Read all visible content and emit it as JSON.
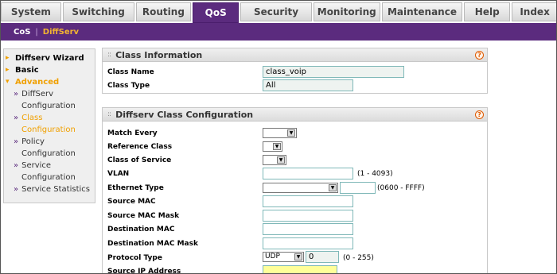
{
  "tabs": [
    "System",
    "Switching",
    "Routing",
    "QoS",
    "Security",
    "Monitoring",
    "Maintenance",
    "Help",
    "Index"
  ],
  "subnav": {
    "cos": "CoS",
    "sep": "|",
    "diffserv": "DiffServ"
  },
  "sidebar": {
    "wizard": "Diffserv Wizard",
    "basic": "Basic",
    "advanced": "Advanced",
    "items": [
      {
        "l1": "DiffServ",
        "l2": "Configuration"
      },
      {
        "l1": "Class",
        "l2": "Configuration"
      },
      {
        "l1": "Policy",
        "l2": "Configuration"
      },
      {
        "l1": "Service",
        "l2": "Configuration"
      },
      {
        "l1": "Service Statistics",
        "l2": ""
      }
    ]
  },
  "class_info": {
    "title": "Class Information",
    "name_label": "Class Name",
    "name_value": "class_voip",
    "type_label": "Class Type",
    "type_value": "All"
  },
  "config": {
    "title": "Diffserv Class Configuration",
    "match_every": "Match Every",
    "reference_class": "Reference Class",
    "class_of_service": "Class of Service",
    "vlan": "VLAN",
    "vlan_hint": "(1 - 4093)",
    "ethernet_type": "Ethernet Type",
    "ethernet_hint": "(0600 - FFFF)",
    "source_mac": "Source MAC",
    "source_mac_mask": "Source MAC Mask",
    "destination_mac": "Destination MAC",
    "destination_mac_mask": "Destination MAC Mask",
    "protocol_type": "Protocol Type",
    "protocol_value": "UDP",
    "protocol_num": "0",
    "protocol_hint": "(0 - 255)",
    "source_ip": "Source IP Address"
  },
  "colors": {
    "accent": "#5b2b7e",
    "highlight": "#f0a000"
  }
}
